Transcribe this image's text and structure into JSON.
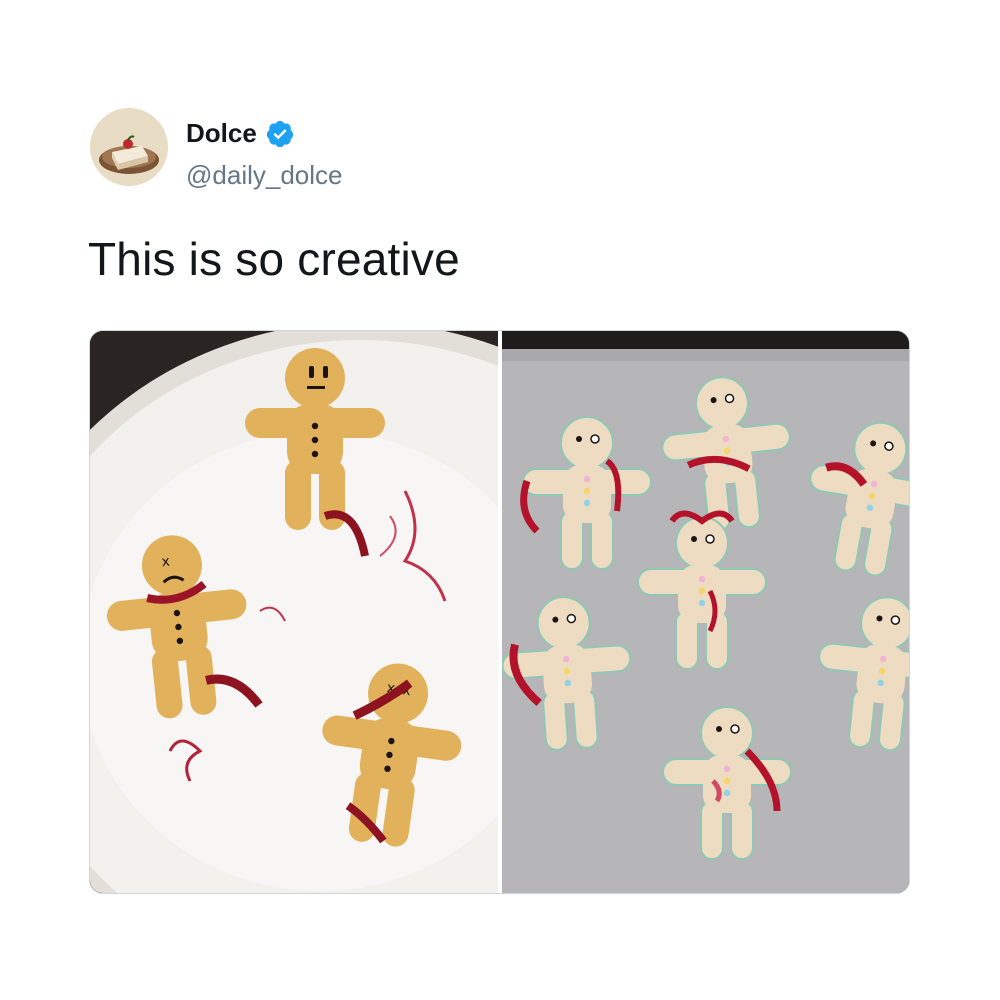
{
  "tweet": {
    "author": {
      "display_name": "Dolce",
      "handle": "@daily_dolce",
      "verified": true,
      "avatar_icon": "cake-slice-avatar"
    },
    "text": "This is so creative",
    "media": {
      "count": 2,
      "photos": [
        {
          "subject": "gingerbread-cookies-on-plate"
        },
        {
          "subject": "gingerbread-cookies-on-baking-tray"
        }
      ]
    },
    "colors": {
      "text": "#14171a",
      "handle": "#657786",
      "verified": "#1da1f2",
      "border": "#ccd6dd"
    }
  }
}
